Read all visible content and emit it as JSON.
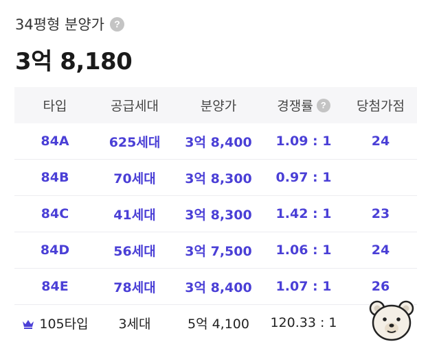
{
  "header": {
    "subtitle": "34평형 분양가",
    "price": "3억 8,180"
  },
  "table": {
    "columns": [
      "타입",
      "공급세대",
      "분양가",
      "경쟁률",
      "당첨가점"
    ],
    "rows": [
      {
        "type": "84A",
        "units": "625세대",
        "price": "3억 8,400",
        "competition": "1.09 : 1",
        "score": "24"
      },
      {
        "type": "84B",
        "units": "70세대",
        "price": "3억 8,300",
        "competition": "0.97 : 1",
        "score": ""
      },
      {
        "type": "84C",
        "units": "41세대",
        "price": "3억 8,300",
        "competition": "1.42 : 1",
        "score": "23"
      },
      {
        "type": "84D",
        "units": "56세대",
        "price": "3억 7,500",
        "competition": "1.06 : 1",
        "score": "24"
      },
      {
        "type": "84E",
        "units": "78세대",
        "price": "3억 8,400",
        "competition": "1.07 : 1",
        "score": "26"
      }
    ],
    "footer": {
      "type": "105타입",
      "units": "3세대",
      "price": "5억 4,100",
      "competition": "120.33 : 1",
      "score": ""
    }
  },
  "icons": {
    "help": "question-circle-icon",
    "crown": "crown-icon",
    "mascot": "bear-mascot-icon"
  },
  "colors": {
    "accent": "#4a3fd6",
    "header_bg": "#f6f6f8",
    "help_gray": "#c4c4c4"
  }
}
